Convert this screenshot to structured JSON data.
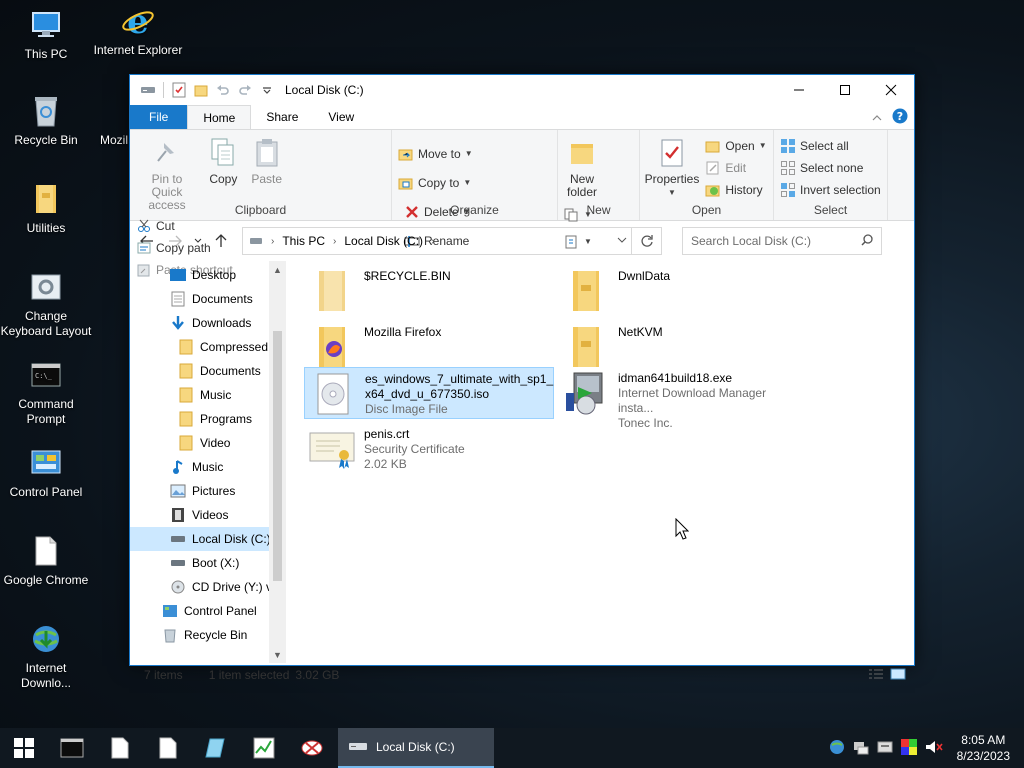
{
  "desktop": {
    "icons": [
      {
        "label": "This PC"
      },
      {
        "label": "Internet Explorer"
      },
      {
        "label": "Recycle Bin"
      },
      {
        "label": "Mozil"
      },
      {
        "label": "Utilities"
      },
      {
        "label": "Change Keyboard Layout"
      },
      {
        "label": "Command Prompt"
      },
      {
        "label": "Control Panel"
      },
      {
        "label": "Google Chrome"
      },
      {
        "label": "Internet Downlo..."
      }
    ]
  },
  "window": {
    "title": "Local Disk (C:)",
    "tabs": [
      "File",
      "Home",
      "Share",
      "View"
    ],
    "ribbon": {
      "clipboard": {
        "pin": "Pin to Quick access",
        "copy": "Copy",
        "paste": "Paste",
        "cut": "Cut",
        "copy_path": "Copy path",
        "paste_shortcut": "Paste shortcut",
        "group": "Clipboard"
      },
      "organize": {
        "move_to": "Move to",
        "copy_to": "Copy to",
        "delete": "Delete",
        "rename": "Rename",
        "group": "Organize"
      },
      "new": {
        "new_folder": "New folder",
        "group": "New"
      },
      "open": {
        "properties": "Properties",
        "open": "Open",
        "edit": "Edit",
        "history": "History",
        "group": "Open"
      },
      "select": {
        "select_all": "Select all",
        "select_none": "Select none",
        "invert": "Invert selection",
        "group": "Select"
      }
    },
    "address": {
      "crumbs": [
        "This PC",
        "Local Disk (C:)"
      ],
      "search_placeholder": "Search Local Disk (C:)"
    },
    "nav": [
      {
        "label": "Desktop"
      },
      {
        "label": "Documents"
      },
      {
        "label": "Downloads"
      },
      {
        "label": "Compressed"
      },
      {
        "label": "Documents"
      },
      {
        "label": "Music"
      },
      {
        "label": "Programs"
      },
      {
        "label": "Video"
      },
      {
        "label": "Music"
      },
      {
        "label": "Pictures"
      },
      {
        "label": "Videos"
      },
      {
        "label": "Local Disk (C:)"
      },
      {
        "label": "Boot (X:)"
      },
      {
        "label": "CD Drive (Y:) vi"
      },
      {
        "label": "Control Panel"
      },
      {
        "label": "Recycle Bin"
      }
    ],
    "files": [
      {
        "name": "$RECYCLE.BIN",
        "line2": "",
        "line3": ""
      },
      {
        "name": "DwnlData",
        "line2": "",
        "line3": ""
      },
      {
        "name": "Mozilla Firefox",
        "line2": "",
        "line3": ""
      },
      {
        "name": "NetKVM",
        "line2": "",
        "line3": ""
      },
      {
        "name": "es_windows_7_ultimate_with_sp1_x64_dvd_u_677350.iso",
        "line2": "Disc Image File",
        "line3": ""
      },
      {
        "name": "idman641build18.exe",
        "line2": "Internet Download Manager insta...",
        "line3": "Tonec Inc."
      },
      {
        "name": "penis.crt",
        "line2": "Security Certificate",
        "line3": "2.02 KB"
      }
    ],
    "status": {
      "count": "7 items",
      "selected": "1 item selected",
      "size": "3.02 GB"
    }
  },
  "taskbar": {
    "active_window": "Local Disk (C:)",
    "time": "8:05 AM",
    "date": "8/23/2023"
  }
}
